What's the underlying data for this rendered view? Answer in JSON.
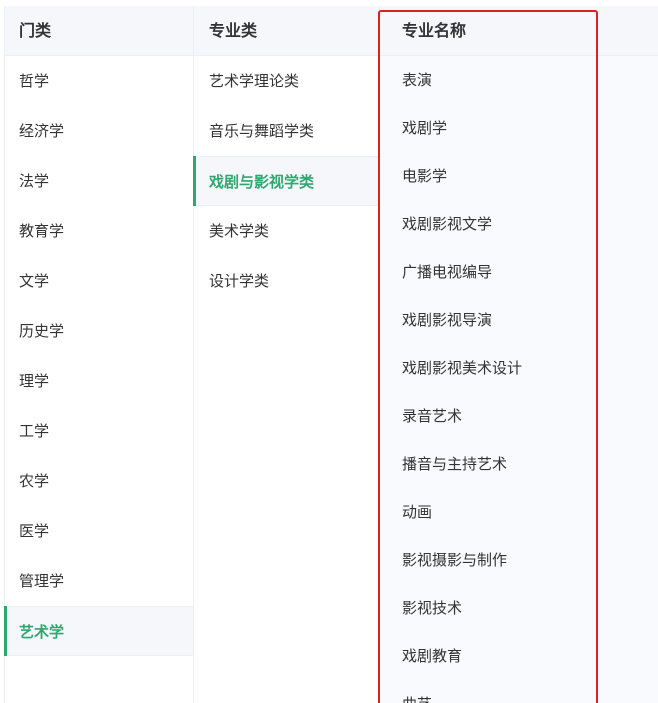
{
  "categories": {
    "header": "门类",
    "items": [
      "哲学",
      "经济学",
      "法学",
      "教育学",
      "文学",
      "历史学",
      "理学",
      "工学",
      "农学",
      "医学",
      "管理学",
      "艺术学"
    ],
    "active_index": 11
  },
  "subcategories": {
    "header": "专业类",
    "items": [
      "艺术学理论类",
      "音乐与舞蹈学类",
      "戏剧与影视学类",
      "美术学类",
      "设计学类"
    ],
    "active_index": 2
  },
  "majors": {
    "header": "专业名称",
    "items": [
      "表演",
      "戏剧学",
      "电影学",
      "戏剧影视文学",
      "广播电视编导",
      "戏剧影视导演",
      "戏剧影视美术设计",
      "录音艺术",
      "播音与主持艺术",
      "动画",
      "影视摄影与制作",
      "影视技术",
      "戏剧教育",
      "曲艺"
    ]
  },
  "colors": {
    "accent": "#2fa870",
    "highlight_box": "#e02020"
  }
}
